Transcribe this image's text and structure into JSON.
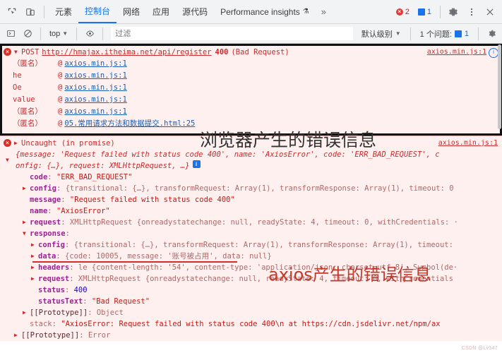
{
  "tabbar": {
    "icons": [
      {
        "name": "inspect-element-icon",
        "glyph": "inspect"
      },
      {
        "name": "device-toolbar-icon",
        "glyph": "device"
      }
    ],
    "tabs": [
      {
        "label": "元素",
        "active": false
      },
      {
        "label": "控制台",
        "active": true
      },
      {
        "label": "网络",
        "active": false
      },
      {
        "label": "应用",
        "active": false
      },
      {
        "label": "源代码",
        "active": false
      },
      {
        "label": "Performance insights",
        "active": false,
        "suffix": "⚗"
      }
    ],
    "overflow_label": "»",
    "error_badge": {
      "count": "2",
      "color": "#e53935"
    },
    "info_badge": {
      "count": "1",
      "color": "#1a73e8"
    },
    "settings_icon": "gear-icon",
    "more_icon": "kebab-menu-icon",
    "close_icon": "close-icon"
  },
  "consolebar": {
    "sidebar_toggle_icon": "console-sidebar-icon",
    "clear_icon": "clear-console-icon",
    "context_value": "top",
    "eye_icon": "live-expression-icon",
    "filter_placeholder": "过滤",
    "filter_value": "",
    "level_label": "默认级别",
    "issues_label": "1 个问题:",
    "issues_count": "1",
    "settings_icon": "console-settings-icon"
  },
  "annotations": {
    "browser_error": "浏览器产生的错误信息",
    "axios_error": "axios产生的错误信息",
    "watermark": "CSDN @Lv547"
  },
  "network_error": {
    "method": "POST",
    "url": "http://hmajax.itheima.net/api/register",
    "status": "400",
    "status_text": "(Bad Request)",
    "source": "axios.min.js:1",
    "stack": [
      {
        "fn": "（匿名）",
        "at": "@",
        "src": "axios.min.js:1"
      },
      {
        "fn": "he",
        "at": "@",
        "src": "axios.min.js:1"
      },
      {
        "fn": "Oe",
        "at": "@",
        "src": "axios.min.js:1"
      },
      {
        "fn": "value",
        "at": "@",
        "src": "axios.min.js:1"
      },
      {
        "fn": "（匿名）",
        "at": "@",
        "src": "axios.min.js:1"
      },
      {
        "fn": "（匿名）",
        "at": "@",
        "src": "05.常用请求方法和数据提交.html:25"
      }
    ]
  },
  "axios_error": {
    "header": "Uncaught (in promise)",
    "source": "axios.min.js:1",
    "summary_line1": "{message: 'Request failed with status code 400', name: 'AxiosError', code: 'ERR_BAD_REQUEST', c",
    "summary_line2": "onfig: {…}, request: XMLHttpRequest, …}",
    "rows": [
      {
        "indent": 2,
        "arrow": "",
        "key": "code",
        "value": "\"ERR_BAD_REQUEST\"",
        "kind": "str"
      },
      {
        "indent": 2,
        "arrow": "▶",
        "key": "config",
        "value": "{transitional: {…}, transformRequest: Array(1), transformResponse: Array(1), timeout: 0",
        "kind": "obj"
      },
      {
        "indent": 2,
        "arrow": "",
        "key": "message",
        "value": "\"Request failed with status code 400\"",
        "kind": "str"
      },
      {
        "indent": 2,
        "arrow": "",
        "key": "name",
        "value": "\"AxiosError\"",
        "kind": "str"
      },
      {
        "indent": 2,
        "arrow": "▶",
        "key": "request",
        "value": "XMLHttpRequest {onreadystatechange: null, readyState: 4, timeout: 0, withCredentials: ·",
        "kind": "obj"
      },
      {
        "indent": 2,
        "arrow": "▼",
        "key": "response",
        "value": "",
        "kind": "obj"
      },
      {
        "indent": 3,
        "arrow": "▶",
        "key": "config",
        "value": "{transitional: {…}, transformRequest: Array(1), transformResponse: Array(1), timeout:",
        "kind": "obj"
      },
      {
        "indent": 3,
        "arrow": "▶",
        "key": "data",
        "value": "{code: 10005, message: '账号被占用', data: null}",
        "kind": "obj",
        "highlight": true
      },
      {
        "indent": 3,
        "arrow": "▶",
        "key": "headers",
        "value": "le {content-length: '54', content-type: 'application/json; charset=utf-8', Symbol(de·",
        "kind": "obj"
      },
      {
        "indent": 3,
        "arrow": "▶",
        "key": "request",
        "value": "XMLHttpRequest {onreadystatechange: null, readyState: 4, timeout: 0, withCredentials",
        "kind": "obj"
      },
      {
        "indent": 3,
        "arrow": "",
        "key": "status",
        "value": "400",
        "kind": "num"
      },
      {
        "indent": 3,
        "arrow": "",
        "key": "statusText",
        "value": "\"Bad Request\"",
        "kind": "str"
      },
      {
        "indent": 3,
        "arrow": "▶",
        "key": "[[Prototype]]",
        "value": "Object",
        "kind": "proto"
      },
      {
        "indent": 2,
        "arrow": "",
        "key": "stack",
        "value": "\"AxiosError: Request failed with status code 400\\n    at https://cdn.jsdelivr.net/npm/ax",
        "kind": "stack"
      },
      {
        "indent": 1,
        "arrow": "▶",
        "key": "[[Prototype]]",
        "value": "Error",
        "kind": "proto"
      }
    ]
  }
}
